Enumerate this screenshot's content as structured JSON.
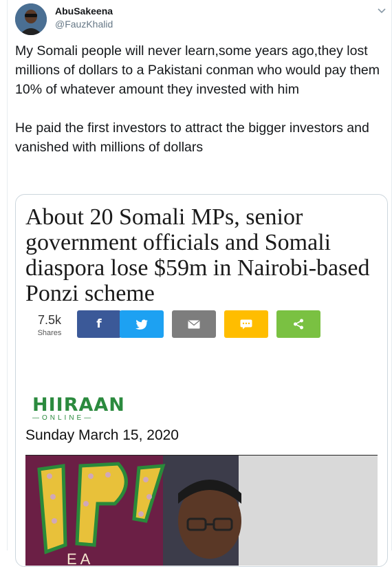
{
  "tweet": {
    "author_name": "AbuSakeena",
    "author_handle": "@FauzKhalid",
    "text": "My Somali people will never learn,some years ago,they lost millions of dollars to a Pakistani conman who would pay them 10% of whatever amount they invested with him\n\nHe paid the first investors to attract the bigger investors and vanished with millions of dollars"
  },
  "card": {
    "headline": "About 20 Somali MPs, senior government officials and Somali diaspora lose $59m in Nairobi-based Ponzi scheme",
    "share_count": "7.5k",
    "share_label": "Shares",
    "share_buttons": [
      {
        "icon": "facebook-icon",
        "color": "#3b5998"
      },
      {
        "icon": "twitter-icon",
        "color": "#1da1f2"
      },
      {
        "icon": "email-icon",
        "color": "#7d7d7d"
      },
      {
        "icon": "sms-icon",
        "color": "#ffbd00"
      },
      {
        "icon": "share-icon",
        "color": "#7ac142"
      }
    ],
    "logo_text": "HIIRAAN",
    "logo_subtext": "ONLINE",
    "date": "Sunday March 15, 2020"
  }
}
